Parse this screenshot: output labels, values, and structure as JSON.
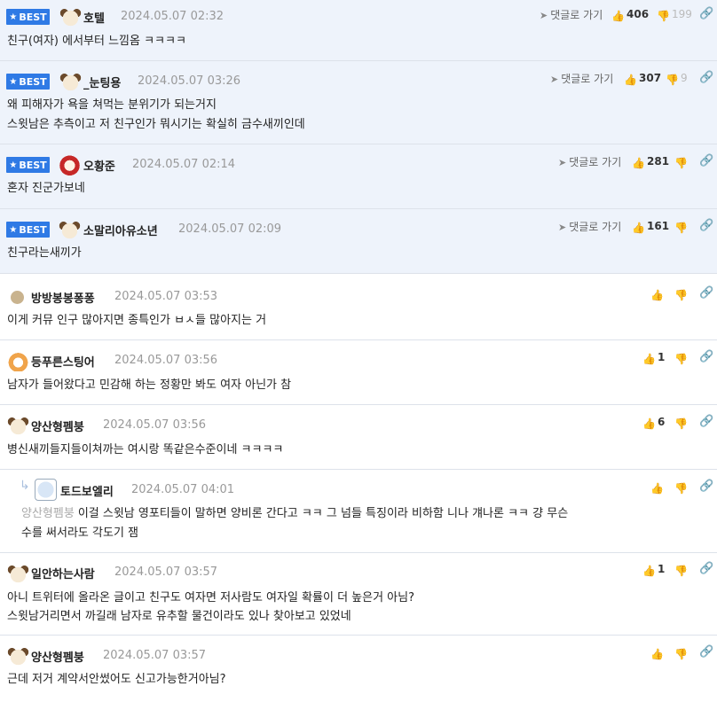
{
  "best_label": "BEST",
  "goto_label": "댓글로 가기",
  "comments": [
    {
      "nick": "호텔",
      "date": "2024.05.07 02:32",
      "lines": [
        "친구(여자) 에서부터 느낌옴 ㅋㅋㅋㅋ"
      ],
      "up": "406",
      "down": "199",
      "avatar": "dog"
    },
    {
      "nick": "_눈팅용",
      "date": "2024.05.07 03:26",
      "lines": [
        "왜 피해자가 욕을 쳐먹는 분위기가 되는거지",
        "스윗남은 추측이고 저 친구인가 뭐시기는 확실히 금수새끼인데"
      ],
      "up": "307",
      "down": "9",
      "avatar": "dog"
    },
    {
      "nick": "오황준",
      "date": "2024.05.07 02:14",
      "lines": [
        "혼자 진군가보네"
      ],
      "up": "281",
      "down": "",
      "avatar": "lion"
    },
    {
      "nick": "소말리아유소년",
      "date": "2024.05.07 02:09",
      "lines": [
        "친구라는새끼가"
      ],
      "up": "161",
      "down": "",
      "avatar": "dog"
    },
    {
      "nick": "방방봉봉퐁퐁",
      "date": "2024.05.07 03:53",
      "lines": [
        "이게 커뮤 인구 많아지면 종특인가 ㅂㅅ들 많아지는 거"
      ],
      "up": "",
      "down": "",
      "avatar": "dot"
    },
    {
      "nick": "등푸른스팅어",
      "date": "2024.05.07 03:56",
      "lines": [
        "남자가 들어왔다고 민감해 하는 정황만 봐도 여자 아닌가 참"
      ],
      "up": "1",
      "down": "",
      "avatar": "fox"
    },
    {
      "nick": "양산형펨붕",
      "date": "2024.05.07 03:56",
      "lines": [
        "병신새끼들지들이쳐까는 여시랑 똑같은수준이네 ㅋㅋㅋㅋ"
      ],
      "up": "6",
      "down": "",
      "avatar": "dog"
    },
    {
      "nick": "토드보엘리",
      "date": "2024.05.07 04:01",
      "mention": "양산형펨붕",
      "lines": [
        "이걸 스윗남 영포티들이 말하면 양비론 간다고 ㅋㅋ 그 넘들 특징이라 비하함 니나 걔나론 ㅋㅋ 걍 무슨",
        "수를 써서라도 각도기 잼"
      ],
      "up": "",
      "down": "",
      "avatar": "ghost"
    },
    {
      "nick": "일안하는사람",
      "date": "2024.05.07 03:57",
      "lines": [
        "아니 트위터에 올라온 글이고 친구도 여자면 저사람도 여자일 확률이 더 높은거 아님?",
        "스윗남거리면서 까길래 남자로 유추할 물건이라도 있나 찾아보고 있었네"
      ],
      "up": "1",
      "down": "",
      "avatar": "dog"
    },
    {
      "nick": "양산형펨붕",
      "date": "2024.05.07 03:57",
      "lines": [
        "근데 저거 계약서안썼어도 신고가능한거아님?"
      ],
      "up": "",
      "down": "",
      "avatar": "dog"
    }
  ]
}
